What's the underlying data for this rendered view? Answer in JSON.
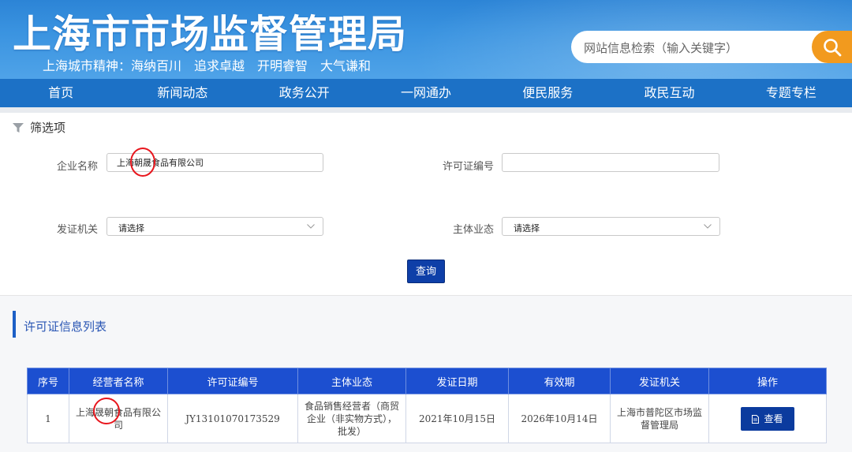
{
  "header": {
    "title": "上海市市场监督管理局",
    "motto": "上海城市精神：海纳百川　追求卓越　开明睿智　大气谦和",
    "search_placeholder": "网站信息检索（输入关键字）",
    "search_icon": "search-icon",
    "accent_color": "#f29a1e"
  },
  "nav": {
    "items": [
      "首页",
      "新闻动态",
      "政务公开",
      "一网通办",
      "便民服务",
      "政民互动",
      "专题专栏"
    ]
  },
  "filter": {
    "title": "筛选项",
    "company_label": "企业名称",
    "company_value": "上海朝晟食品有限公司",
    "license_label": "许可证编号",
    "license_value": "",
    "authority_label": "发证机关",
    "authority_value": "请选择",
    "business_label": "主体业态",
    "business_value": "请选择",
    "query_label": "查询"
  },
  "list": {
    "title": "许可证信息列表",
    "columns": [
      "序号",
      "经营者名称",
      "许可证编号",
      "主体业态",
      "发证日期",
      "有效期",
      "发证机关",
      "操作"
    ],
    "rows": [
      {
        "index": "1",
        "name": "上海晟朝食品有限公司",
        "license": "JY13101070173529",
        "business": "食品销售经营者（商贸企业（非实物方式），批发）",
        "issue_date": "2021年10月15日",
        "valid_until": "2026年10月14日",
        "authority": "上海市普陀区市场监督管理局",
        "action": "查看"
      }
    ]
  }
}
